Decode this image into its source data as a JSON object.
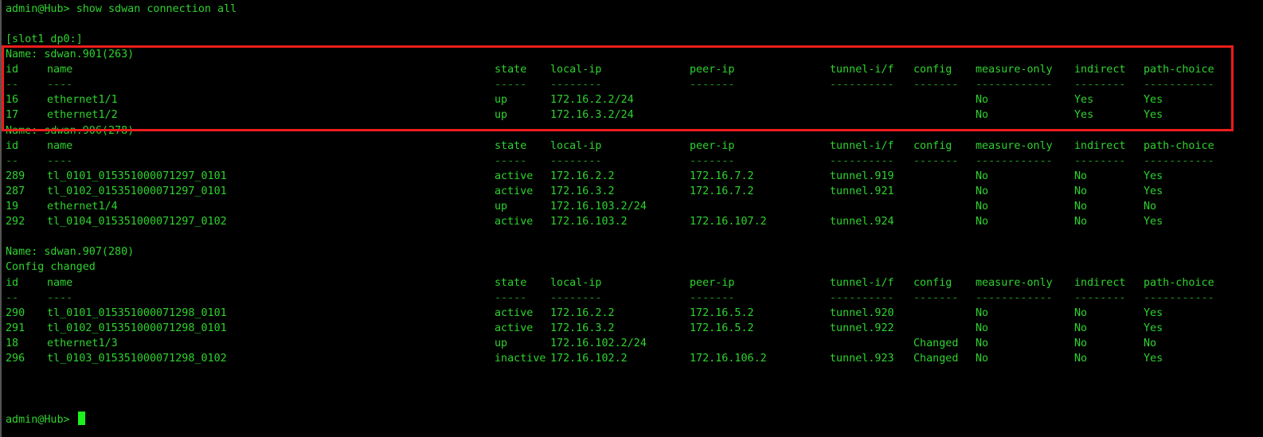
{
  "terminal": {
    "prompt": "admin@Hub>",
    "command": "show sdwan connection all",
    "slot_label": "[slot1 dp0:]",
    "columns": [
      "id",
      "name",
      "state",
      "local-ip",
      "peer-ip",
      "tunnel-i/f",
      "config",
      "measure-only",
      "indirect",
      "path-choice"
    ],
    "underlines": [
      "--",
      "----",
      "-----",
      "--------",
      "-------",
      "----------",
      "-------",
      "------------",
      "--------",
      "-----------"
    ],
    "sections": [
      {
        "name_line": "Name: sdwan.901(263)",
        "note": "",
        "highlighted": true,
        "rows": [
          [
            "16",
            "ethernet1/1",
            "up",
            "172.16.2.2/24",
            "",
            "",
            "",
            "No",
            "Yes",
            "Yes"
          ],
          [
            "17",
            "ethernet1/2",
            "up",
            "172.16.3.2/24",
            "",
            "",
            "",
            "No",
            "Yes",
            "Yes"
          ]
        ]
      },
      {
        "name_line": "Name: sdwan.906(278)",
        "note": "",
        "highlighted": false,
        "rows": [
          [
            "289",
            "tl_0101_015351000071297_0101",
            "active",
            "172.16.2.2",
            "172.16.7.2",
            "tunnel.919",
            "",
            "No",
            "No",
            "Yes"
          ],
          [
            "287",
            "tl_0102_015351000071297_0101",
            "active",
            "172.16.3.2",
            "172.16.7.2",
            "tunnel.921",
            "",
            "No",
            "No",
            "Yes"
          ],
          [
            "19",
            "ethernet1/4",
            "up",
            "172.16.103.2/24",
            "",
            "",
            "",
            "No",
            "No",
            "No"
          ],
          [
            "292",
            "tl_0104_015351000071297_0102",
            "active",
            "172.16.103.2",
            "172.16.107.2",
            "tunnel.924",
            "",
            "No",
            "No",
            "Yes"
          ]
        ]
      },
      {
        "name_line": "Name: sdwan.907(280)",
        "note": "Config changed",
        "highlighted": false,
        "rows": [
          [
            "290",
            "tl_0101_015351000071298_0101",
            "active",
            "172.16.2.2",
            "172.16.5.2",
            "tunnel.920",
            "",
            "No",
            "No",
            "Yes"
          ],
          [
            "291",
            "tl_0102_015351000071298_0101",
            "active",
            "172.16.3.2",
            "172.16.5.2",
            "tunnel.922",
            "",
            "No",
            "No",
            "Yes"
          ],
          [
            "18",
            "ethernet1/3",
            "up",
            "172.16.102.2/24",
            "",
            "",
            "Changed",
            "No",
            "No",
            "No"
          ],
          [
            "296",
            "tl_0103_015351000071298_0102",
            "inactive",
            "172.16.102.2",
            "172.16.106.2",
            "tunnel.923",
            "Changed",
            "No",
            "No",
            "Yes"
          ]
        ]
      }
    ],
    "colors": {
      "text": "#2ed32e",
      "background": "#000000",
      "highlight_box": "#ee1c1c",
      "cursor": "#1ef01e"
    }
  }
}
